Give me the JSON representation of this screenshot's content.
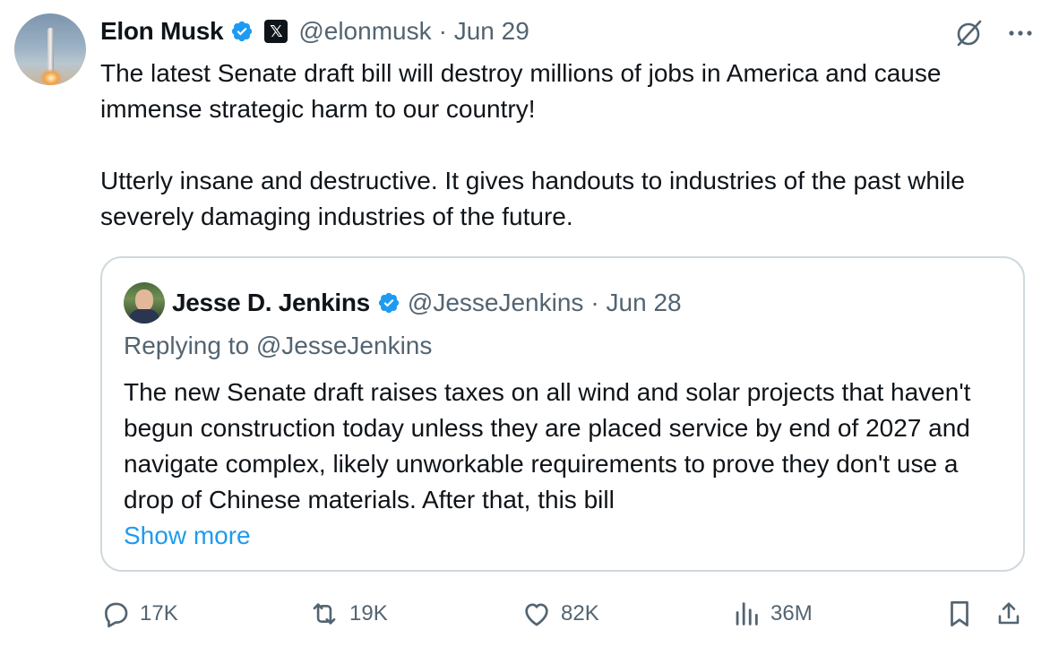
{
  "author": {
    "name": "Elon Musk",
    "handle": "@elonmusk",
    "date": "· Jun 29",
    "x_badge": "𝕏",
    "verified_color": "#1d9bf0"
  },
  "tweet": {
    "text": "The latest Senate draft bill will destroy millions of jobs in America and cause immense strategic harm to our country!\n\nUtterly insane and destructive. It gives handouts to industries of the past while severely damaging industries of the future."
  },
  "quoted": {
    "name": "Jesse D. Jenkins",
    "handle": "@JesseJenkins",
    "date": "· Jun 28",
    "replying_to": "Replying to @JesseJenkins",
    "text": "The new Senate draft raises taxes on all wind and solar projects that haven't begun construction today unless they are placed service by end of 2027 and navigate complex, likely unworkable requirements to prove they don't use a drop of Chinese materials. After that, this bill",
    "show_more": "Show more"
  },
  "actions": {
    "replies": "17K",
    "reposts": "19K",
    "likes": "82K",
    "views": "36M"
  },
  "icons": [
    "grok-icon",
    "more-icon",
    "reply-icon",
    "repost-icon",
    "like-icon",
    "views-icon",
    "bookmark-icon",
    "share-icon"
  ],
  "colors": {
    "accent": "#1d9bf0",
    "muted": "#536471",
    "text": "#0f1419",
    "border": "#cfd9de"
  }
}
